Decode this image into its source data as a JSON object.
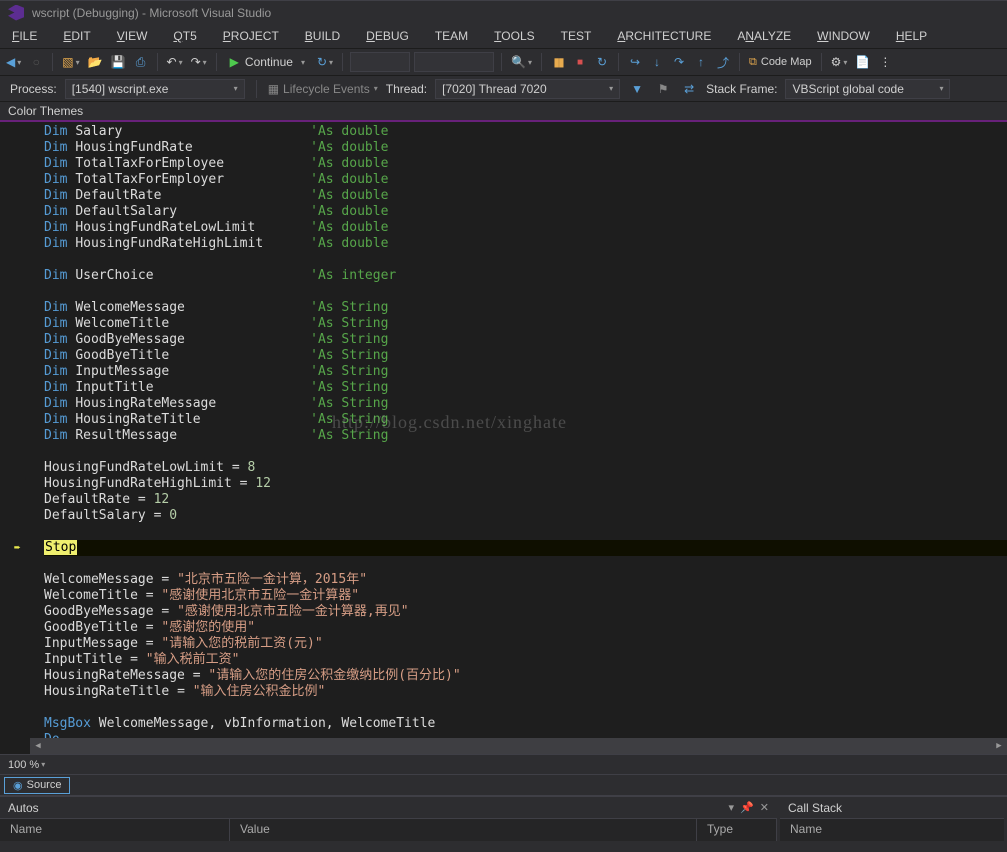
{
  "window": {
    "title": "wscript (Debugging) - Microsoft Visual Studio"
  },
  "menu": [
    "FILE",
    "EDIT",
    "VIEW",
    "QT5",
    "PROJECT",
    "BUILD",
    "DEBUG",
    "TEAM",
    "TOOLS",
    "TEST",
    "ARCHITECTURE",
    "ANALYZE",
    "WINDOW",
    "HELP"
  ],
  "menu_u": [
    "F",
    "E",
    "V",
    "Q",
    "P",
    "B",
    "D",
    "",
    "T",
    "",
    "A",
    "N",
    "W",
    "H"
  ],
  "toolbar": {
    "continue": "Continue",
    "code_map": "Code Map"
  },
  "debug_bar": {
    "process_label": "Process:",
    "process_value": "[1540] wscript.exe",
    "lifecycle": "Lifecycle Events",
    "thread_label": "Thread:",
    "thread_value": "[7020] Thread 7020",
    "stackframe_label": "Stack Frame:",
    "stackframe_value": "VBScript global code"
  },
  "panel_label": "Color Themes",
  "zoom": "100 %",
  "source_tab": "Source",
  "autos": {
    "title": "Autos",
    "col_name": "Name",
    "col_value": "Value",
    "col_type": "Type"
  },
  "callstack": {
    "title": "Call Stack",
    "col_name": "Name"
  },
  "code": {
    "decls": [
      {
        "name": "Salary",
        "comment": "'As double"
      },
      {
        "name": "HousingFundRate",
        "comment": "'As double"
      },
      {
        "name": "TotalTaxForEmployee",
        "comment": "'As double"
      },
      {
        "name": "TotalTaxForEmployer",
        "comment": "'As double"
      },
      {
        "name": "DefaultRate",
        "comment": "'As double"
      },
      {
        "name": "DefaultSalary",
        "comment": "'As double"
      },
      {
        "name": "HousingFundRateLowLimit",
        "comment": "'As double"
      },
      {
        "name": "HousingFundRateHighLimit",
        "comment": "'As double"
      },
      {
        "name": "",
        "comment": ""
      },
      {
        "name": "UserChoice",
        "comment": "'As integer"
      },
      {
        "name": "",
        "comment": ""
      },
      {
        "name": "WelcomeMessage",
        "comment": "'As String"
      },
      {
        "name": "WelcomeTitle",
        "comment": "'As String"
      },
      {
        "name": "GoodByeMessage",
        "comment": "'As String"
      },
      {
        "name": "GoodByeTitle",
        "comment": "'As String"
      },
      {
        "name": "InputMessage",
        "comment": "'As String"
      },
      {
        "name": "InputTitle",
        "comment": "'As String"
      },
      {
        "name": "HousingRateMessage",
        "comment": "'As String"
      },
      {
        "name": "HousingRateTitle",
        "comment": "'As String"
      },
      {
        "name": "ResultMessage",
        "comment": "'As String"
      }
    ],
    "assigns_num": [
      {
        "lhs": "HousingFundRateLowLimit",
        "val": "8"
      },
      {
        "lhs": "HousingFundRateHighLimit",
        "val": "12"
      },
      {
        "lhs": "DefaultRate",
        "val": "12"
      },
      {
        "lhs": "DefaultSalary",
        "val": "0"
      }
    ],
    "stop": "Stop",
    "assigns_str": [
      {
        "lhs": "WelcomeMessage",
        "val": "\"北京市五险一金计算，2015年\""
      },
      {
        "lhs": "WelcomeTitle",
        "val": "\"感谢使用北京市五险一金计算器\""
      },
      {
        "lhs": "GoodByeMessage",
        "val": "\"感谢使用北京市五险一金计算器,再见\""
      },
      {
        "lhs": "GoodByeTitle",
        "val": "\"感谢您的使用\""
      },
      {
        "lhs": "InputMessage",
        "val": "\"请输入您的税前工资(元)\""
      },
      {
        "lhs": "InputTitle",
        "val": "\"输入税前工资\""
      },
      {
        "lhs": "HousingRateMessage",
        "val": "\"请输入您的住房公积金缴纳比例(百分比)\""
      },
      {
        "lhs": "HousingRateTitle",
        "val": "\"输入住房公积金比例\""
      }
    ],
    "msgbox": "MsgBox WelcomeMessage, vbInformation, WelcomeTitle",
    "do": "Do"
  },
  "watermark": "http://blog.csdn.net/xinghate"
}
